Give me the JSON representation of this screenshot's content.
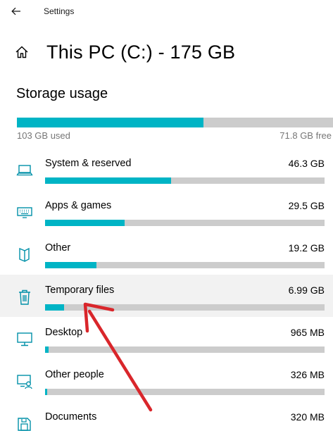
{
  "window": {
    "title": "Settings",
    "back_icon": "back-arrow-icon"
  },
  "header": {
    "title": "This PC (C:) - 175 GB",
    "home_icon": "home-icon"
  },
  "storage": {
    "section_title": "Storage usage",
    "used_label": "103 GB used",
    "free_label": "71.8 GB free",
    "used_fraction": 0.59
  },
  "categories": [
    {
      "label": "System & reserved",
      "size": "46.3 GB",
      "fraction": 0.45,
      "icon": "laptop-icon"
    },
    {
      "label": "Apps & games",
      "size": "29.5 GB",
      "fraction": 0.285,
      "icon": "keyboard-icon"
    },
    {
      "label": "Other",
      "size": "19.2 GB",
      "fraction": 0.185,
      "icon": "other-files-icon"
    },
    {
      "label": "Temporary files",
      "size": "6.99 GB",
      "fraction": 0.068,
      "icon": "trash-icon"
    },
    {
      "label": "Desktop",
      "size": "965 MB",
      "fraction": 0.012,
      "icon": "monitor-icon"
    },
    {
      "label": "Other people",
      "size": "326 MB",
      "fraction": 0.008,
      "icon": "other-people-icon"
    },
    {
      "label": "Documents",
      "size": "320 MB",
      "fraction": 0.008,
      "icon": "documents-icon"
    }
  ],
  "colors": {
    "accent": "#00b4c5",
    "bar_track": "#cccccc",
    "muted_text": "#767676",
    "highlight_row": "#f2f2f2",
    "annotation_arrow": "#d9262b"
  }
}
